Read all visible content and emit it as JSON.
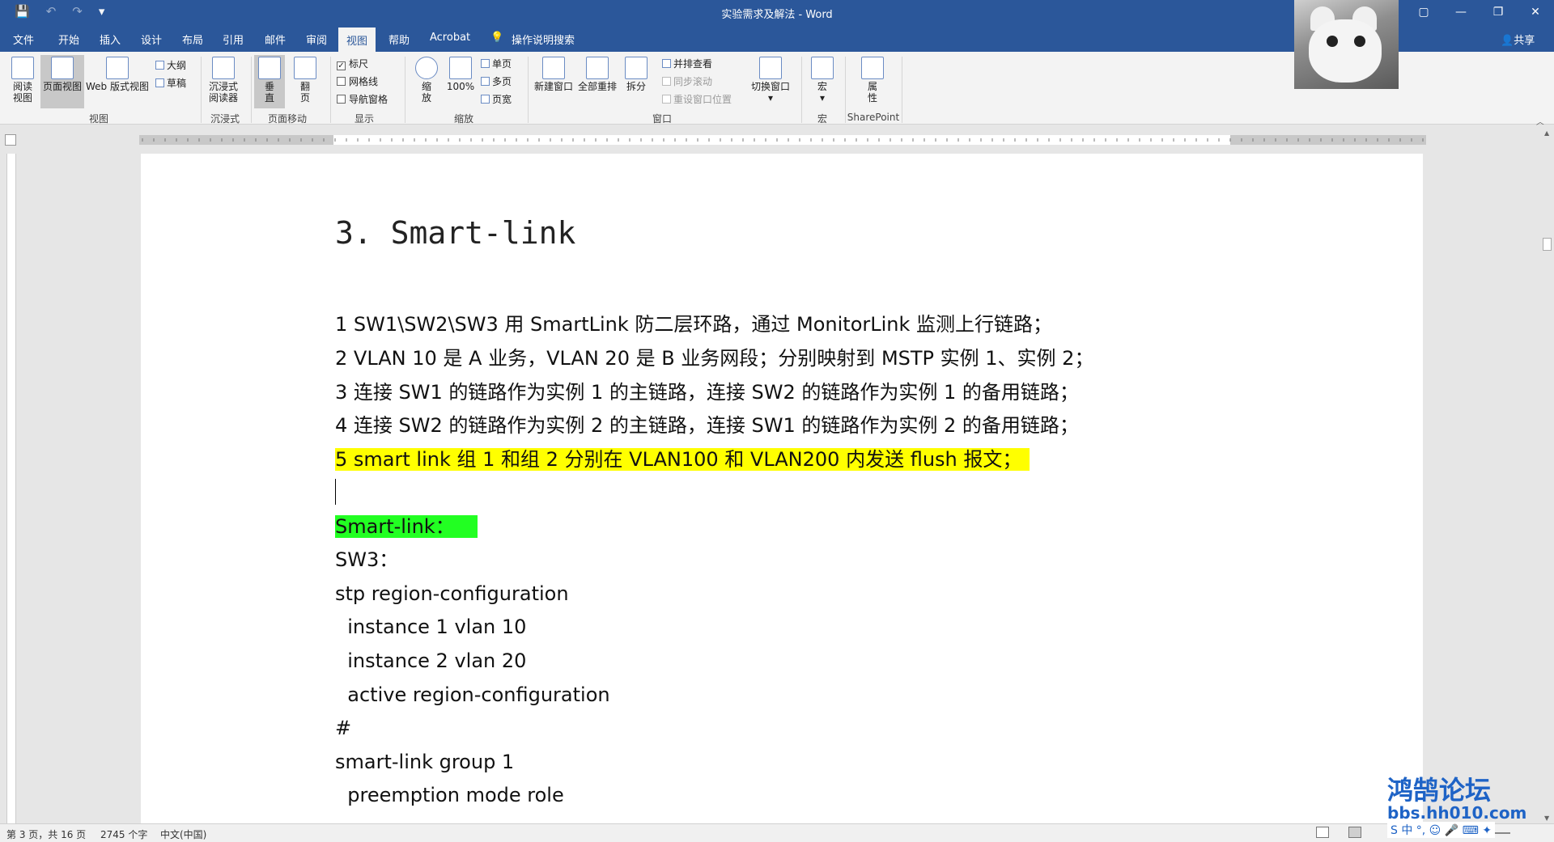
{
  "window": {
    "title": "实验需求及解法  -  Word",
    "controls": [
      "▢",
      "—",
      "❐",
      "✕"
    ]
  },
  "qat": {
    "save": "💾",
    "undo": "↶",
    "redo": "↷",
    "more": "▾"
  },
  "tabs": [
    {
      "label": "文件"
    },
    {
      "label": "开始"
    },
    {
      "label": "插入"
    },
    {
      "label": "设计"
    },
    {
      "label": "布局"
    },
    {
      "label": "引用"
    },
    {
      "label": "邮件"
    },
    {
      "label": "审阅"
    },
    {
      "label": "视图"
    },
    {
      "label": "帮助"
    },
    {
      "label": "Acrobat"
    },
    {
      "label": "操作说明搜索"
    }
  ],
  "share": "共享",
  "ribbon": {
    "views": {
      "read": "阅读\n视图",
      "print": "页面视图",
      "web": "Web 版式视图",
      "outline": "大纲",
      "draft": "草稿",
      "group": "视图"
    },
    "immersive": {
      "reader": "沉浸式\n阅读器",
      "group": "沉浸式"
    },
    "page_move": {
      "vertical": "垂\n直",
      "side": "翻\n页",
      "group": "页面移动"
    },
    "show": {
      "ruler": "标尺",
      "gridlines": "网格线",
      "nav": "导航窗格",
      "group": "显示"
    },
    "zoom": {
      "zoom": "缩\n放",
      "pct": "100%",
      "one_page": "单页",
      "multi_page": "多页",
      "page_width": "页宽",
      "group": "缩放"
    },
    "window": {
      "new": "新建窗口",
      "arrange": "全部重排",
      "split": "拆分",
      "side_by_side": "并排查看",
      "sync_scroll": "同步滚动",
      "reset_pos": "重设窗口位置",
      "switch": "切换窗口",
      "group": "窗口"
    },
    "macros": {
      "macros": "宏",
      "group": "宏"
    },
    "sharepoint": {
      "props": "属\n性",
      "group": "SharePoint"
    }
  },
  "document": {
    "heading": "3. Smart-link",
    "lines": [
      "1 SW1\\SW2\\SW3 用 SmartLink 防二层环路，通过 MonitorLink 监测上行链路；",
      "2 VLAN 10 是 A 业务，VLAN 20 是 B 业务网段；分别映射到 MSTP 实例 1、实例 2；",
      "3  连接 SW1 的链路作为实例 1 的主链路，连接 SW2 的链路作为实例 1 的备用链路；",
      "4  连接 SW2 的链路作为实例 2 的主链路，连接 SW1 的链路作为实例 2 的备用链路；",
      "5 smart link 组 1 和组 2 分别在 VLAN100 和 VLAN200 内发送 flush 报文；",
      "",
      "Smart-link：",
      "SW3：",
      "stp region-configuration",
      "  instance 1 vlan 10",
      "  instance 2 vlan 20",
      "  active region-configuration",
      "#",
      "smart-link group 1",
      "  preemption mode role"
    ]
  },
  "status": {
    "page": "第 3 页，共 16 页",
    "words": "2745 个字",
    "lang": "中文(中国)"
  },
  "watermark": {
    "name": "鸿鹄论坛",
    "url": "bbs.hh010.com"
  },
  "ime": "S 中 °, ☺ 🎤 ⌨ ✦"
}
